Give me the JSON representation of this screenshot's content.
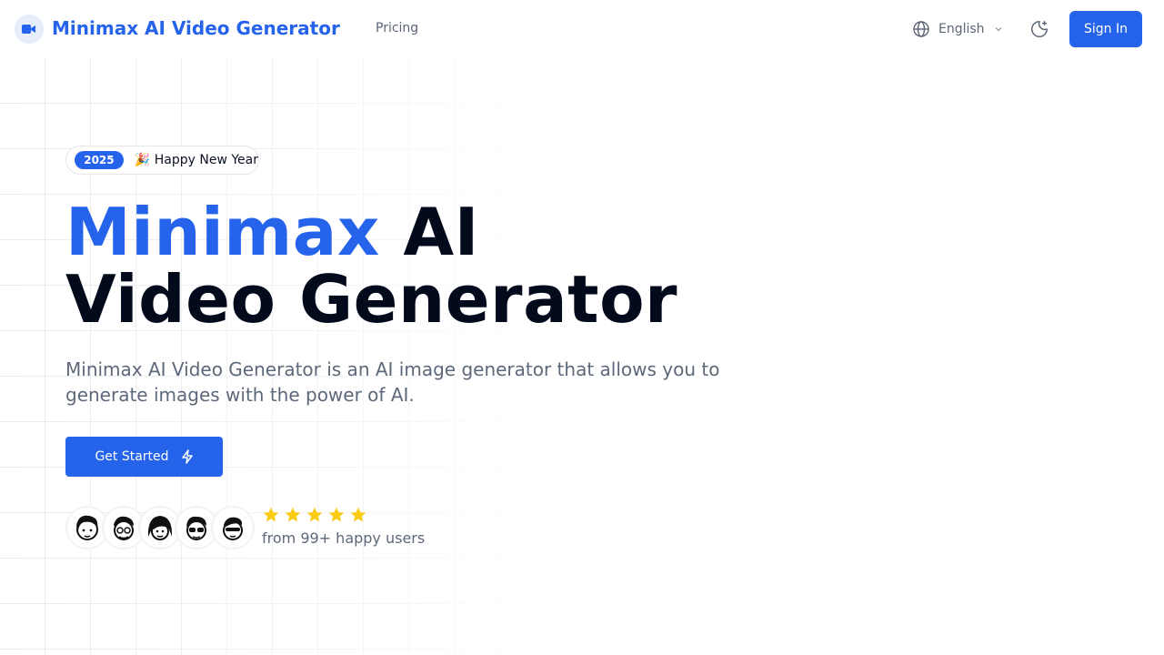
{
  "header": {
    "brand": "Minimax AI Video Generator",
    "nav": {
      "pricing": "Pricing"
    },
    "language": "English",
    "sign_in": "Sign In"
  },
  "hero": {
    "badge": {
      "year": "2025",
      "text": "🎉 Happy New Year"
    },
    "title_accent": "Minimax",
    "title_rest": "AI",
    "title_line2": "Video Generator",
    "description": "Minimax AI Video Generator is an AI image generator that allows you to generate images with the power of AI.",
    "cta": "Get Started",
    "rating": {
      "stars": 5,
      "max": 5,
      "text": "from 99+ happy users"
    }
  },
  "colors": {
    "accent": "#2563eb",
    "star": "#facc15",
    "text": "#030a1c",
    "muted": "#5d687a"
  },
  "icons": [
    "video-camera-icon",
    "globe-icon",
    "chevron-down-icon",
    "moon-sparkle-icon",
    "lightning-icon",
    "star-icon"
  ]
}
